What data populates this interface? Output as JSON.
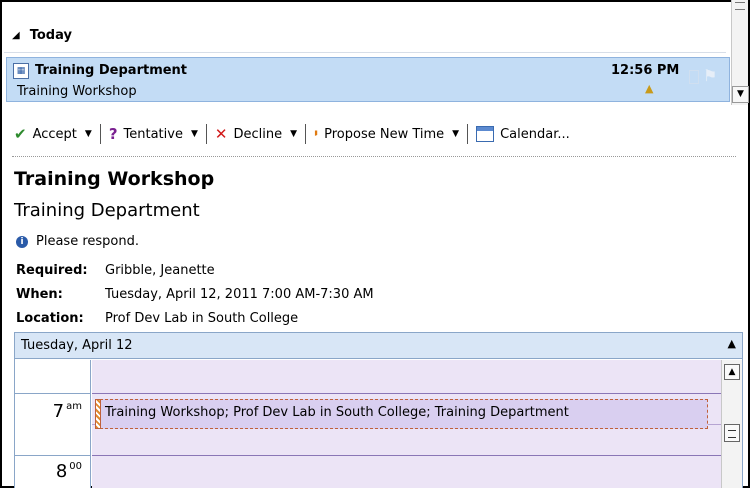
{
  "list": {
    "group_label": "Today",
    "item": {
      "from": "Training Department",
      "subject": "Training Workshop",
      "time": "12:56 PM",
      "icon": "meeting-request-icon"
    }
  },
  "actions": [
    {
      "label": "Accept",
      "icon": "check-icon"
    },
    {
      "label": "Tentative",
      "icon": "question-icon"
    },
    {
      "label": "Decline",
      "icon": "x-icon"
    },
    {
      "label": "Propose New Time",
      "icon": "propose-time-icon"
    },
    {
      "label": "Calendar...",
      "icon": "calendar-icon"
    }
  ],
  "meeting": {
    "subject": "Training Workshop",
    "organizer": "Training Department",
    "notice": "Please respond.",
    "required_label": "Required:",
    "required_value": "Gribble, Jeanette",
    "when_label": "When:",
    "when_value": "Tuesday, April 12, 2011 7:00 AM-7:30 AM",
    "location_label": "Location:",
    "location_value": "Prof Dev Lab in South College"
  },
  "calendar": {
    "date": "Tuesday, April 12",
    "hour_7": "7",
    "hour_7_suffix": "am",
    "hour_8": "8",
    "hour_8_suffix": "00",
    "appointment": "Training Workshop; Prof Dev Lab in South College; Training Department"
  },
  "colors": {
    "selection": "#c3dcf5",
    "calendar_bg": "#ece4f6",
    "calendar_header": "#d8e6f6"
  }
}
